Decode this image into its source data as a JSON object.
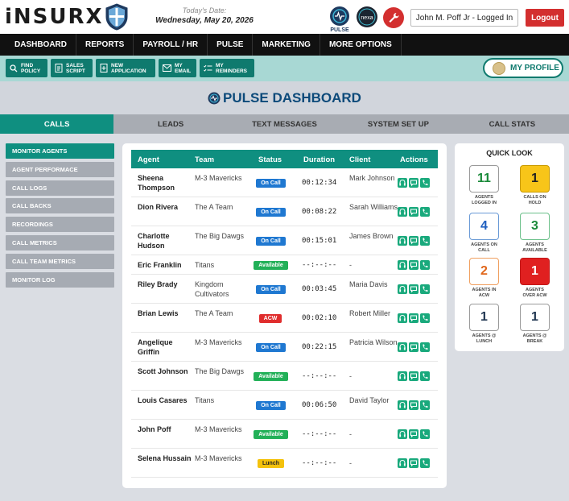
{
  "app": {
    "logo_text": "iNSURX",
    "date_label": "Today's Date:",
    "date_value": "Wednesday, May 20, 2026",
    "pulse_logo_text": "PULSE",
    "nexa_logo_text": "nexa",
    "user_status": "John M. Poff Jr - Logged In",
    "logout_label": "Logout"
  },
  "nav": [
    "DASHBOARD",
    "REPORTS",
    "PAYROLL / HR",
    "PULSE",
    "MARKETING",
    "MORE OPTIONS"
  ],
  "quickbar": {
    "find_policy": "FIND POLICY",
    "sales_script": "SALES SCRIPT",
    "new_application": "NEW APPLICATION",
    "my_email": "MY EMAIL",
    "my_reminders": "MY REMINDERS",
    "my_profile": "MY PROFILE"
  },
  "page_title": "PULSE DASHBOARD",
  "tabs": [
    "CALLS",
    "LEADS",
    "TEXT MESSAGES",
    "SYSTEM SET UP",
    "CALL STATS"
  ],
  "sidebar": [
    "MONITOR AGENTS",
    "AGENT PERFORMACE",
    "CALL LOGS",
    "CALL BACKS",
    "RECORDINGS",
    "CALL METRICS",
    "CALL TEAM METRICS",
    "MONITOR LOG"
  ],
  "table": {
    "headers": [
      "Agent",
      "Team",
      "Status",
      "Duration",
      "Client",
      "Actions"
    ],
    "rows": [
      {
        "agent": "Sheena Thompson",
        "team": "M-3 Mavericks",
        "status": "On Call",
        "duration": "00:12:34",
        "client": "Mark Johnson"
      },
      {
        "agent": "Dion Rivera",
        "team": "The A Team",
        "status": "On Call",
        "duration": "00:08:22",
        "client": "Sarah Williams"
      },
      {
        "agent": "Charlotte Hudson",
        "team": "The Big Dawgs",
        "status": "On Call",
        "duration": "00:15:01",
        "client": "James Brown"
      },
      {
        "agent": "Eric Franklin",
        "team": "Titans",
        "status": "Available",
        "duration": "--:--:--",
        "client": "-"
      },
      {
        "agent": "Riley Brady",
        "team": "Kingdom Cultivators",
        "status": "On Call",
        "duration": "00:03:45",
        "client": "Maria Davis"
      },
      {
        "agent": "Brian Lewis",
        "team": "The A Team",
        "status": "ACW",
        "duration": "00:02:10",
        "client": "Robert Miller"
      },
      {
        "agent": "Angelique Griffin",
        "team": "M-3 Mavericks",
        "status": "On Call",
        "duration": "00:22:15",
        "client": "Patricia Wilson"
      },
      {
        "agent": "Scott Johnson",
        "team": "The Big Dawgs",
        "status": "Available",
        "duration": "--:--:--",
        "client": "-"
      },
      {
        "agent": "Louis Casares",
        "team": "Titans",
        "status": "On Call",
        "duration": "00:06:50",
        "client": "David Taylor"
      },
      {
        "agent": "John Poff",
        "team": "M-3 Mavericks",
        "status": "Available",
        "duration": "--:--:--",
        "client": "-"
      },
      {
        "agent": "Selena Hussain",
        "team": "M-3 Mavericks",
        "status": "Lunch",
        "duration": "--:--:--",
        "client": "-"
      }
    ]
  },
  "quick_look": {
    "title": "QUICK LOOK",
    "items": [
      {
        "value": "11",
        "label": "AGENTS LOGGED IN",
        "color": "#1a8a3a",
        "border": "#9a9a9a",
        "fill": "#ffffff"
      },
      {
        "value": "1",
        "label": "CALLS ON HOLD",
        "color": "#222222",
        "border": "#c99a00",
        "fill": "#f8c519"
      },
      {
        "value": "4",
        "label": "AGENTS ON CALL",
        "color": "#1f5fbf",
        "border": "#6a9ad6",
        "fill": "#ffffff"
      },
      {
        "value": "3",
        "label": "AGENTS AVAILABLE",
        "color": "#1a8a3a",
        "border": "#6cc08a",
        "fill": "#ffffff"
      },
      {
        "value": "2",
        "label": "AGENTS IN ACW",
        "color": "#e0661a",
        "border": "#f0a060",
        "fill": "#ffffff"
      },
      {
        "value": "1",
        "label": "AGENTS OVER ACW",
        "color": "#ffffff",
        "border": "#c21818",
        "fill": "#e02020"
      },
      {
        "value": "1",
        "label": "AGENTS @ LUNCH",
        "color": "#1f3550",
        "border": "#9a9a9a",
        "fill": "#ffffff"
      },
      {
        "value": "1",
        "label": "AGENTS @ BREAK",
        "color": "#1f3550",
        "border": "#9a9a9a",
        "fill": "#ffffff"
      }
    ]
  }
}
